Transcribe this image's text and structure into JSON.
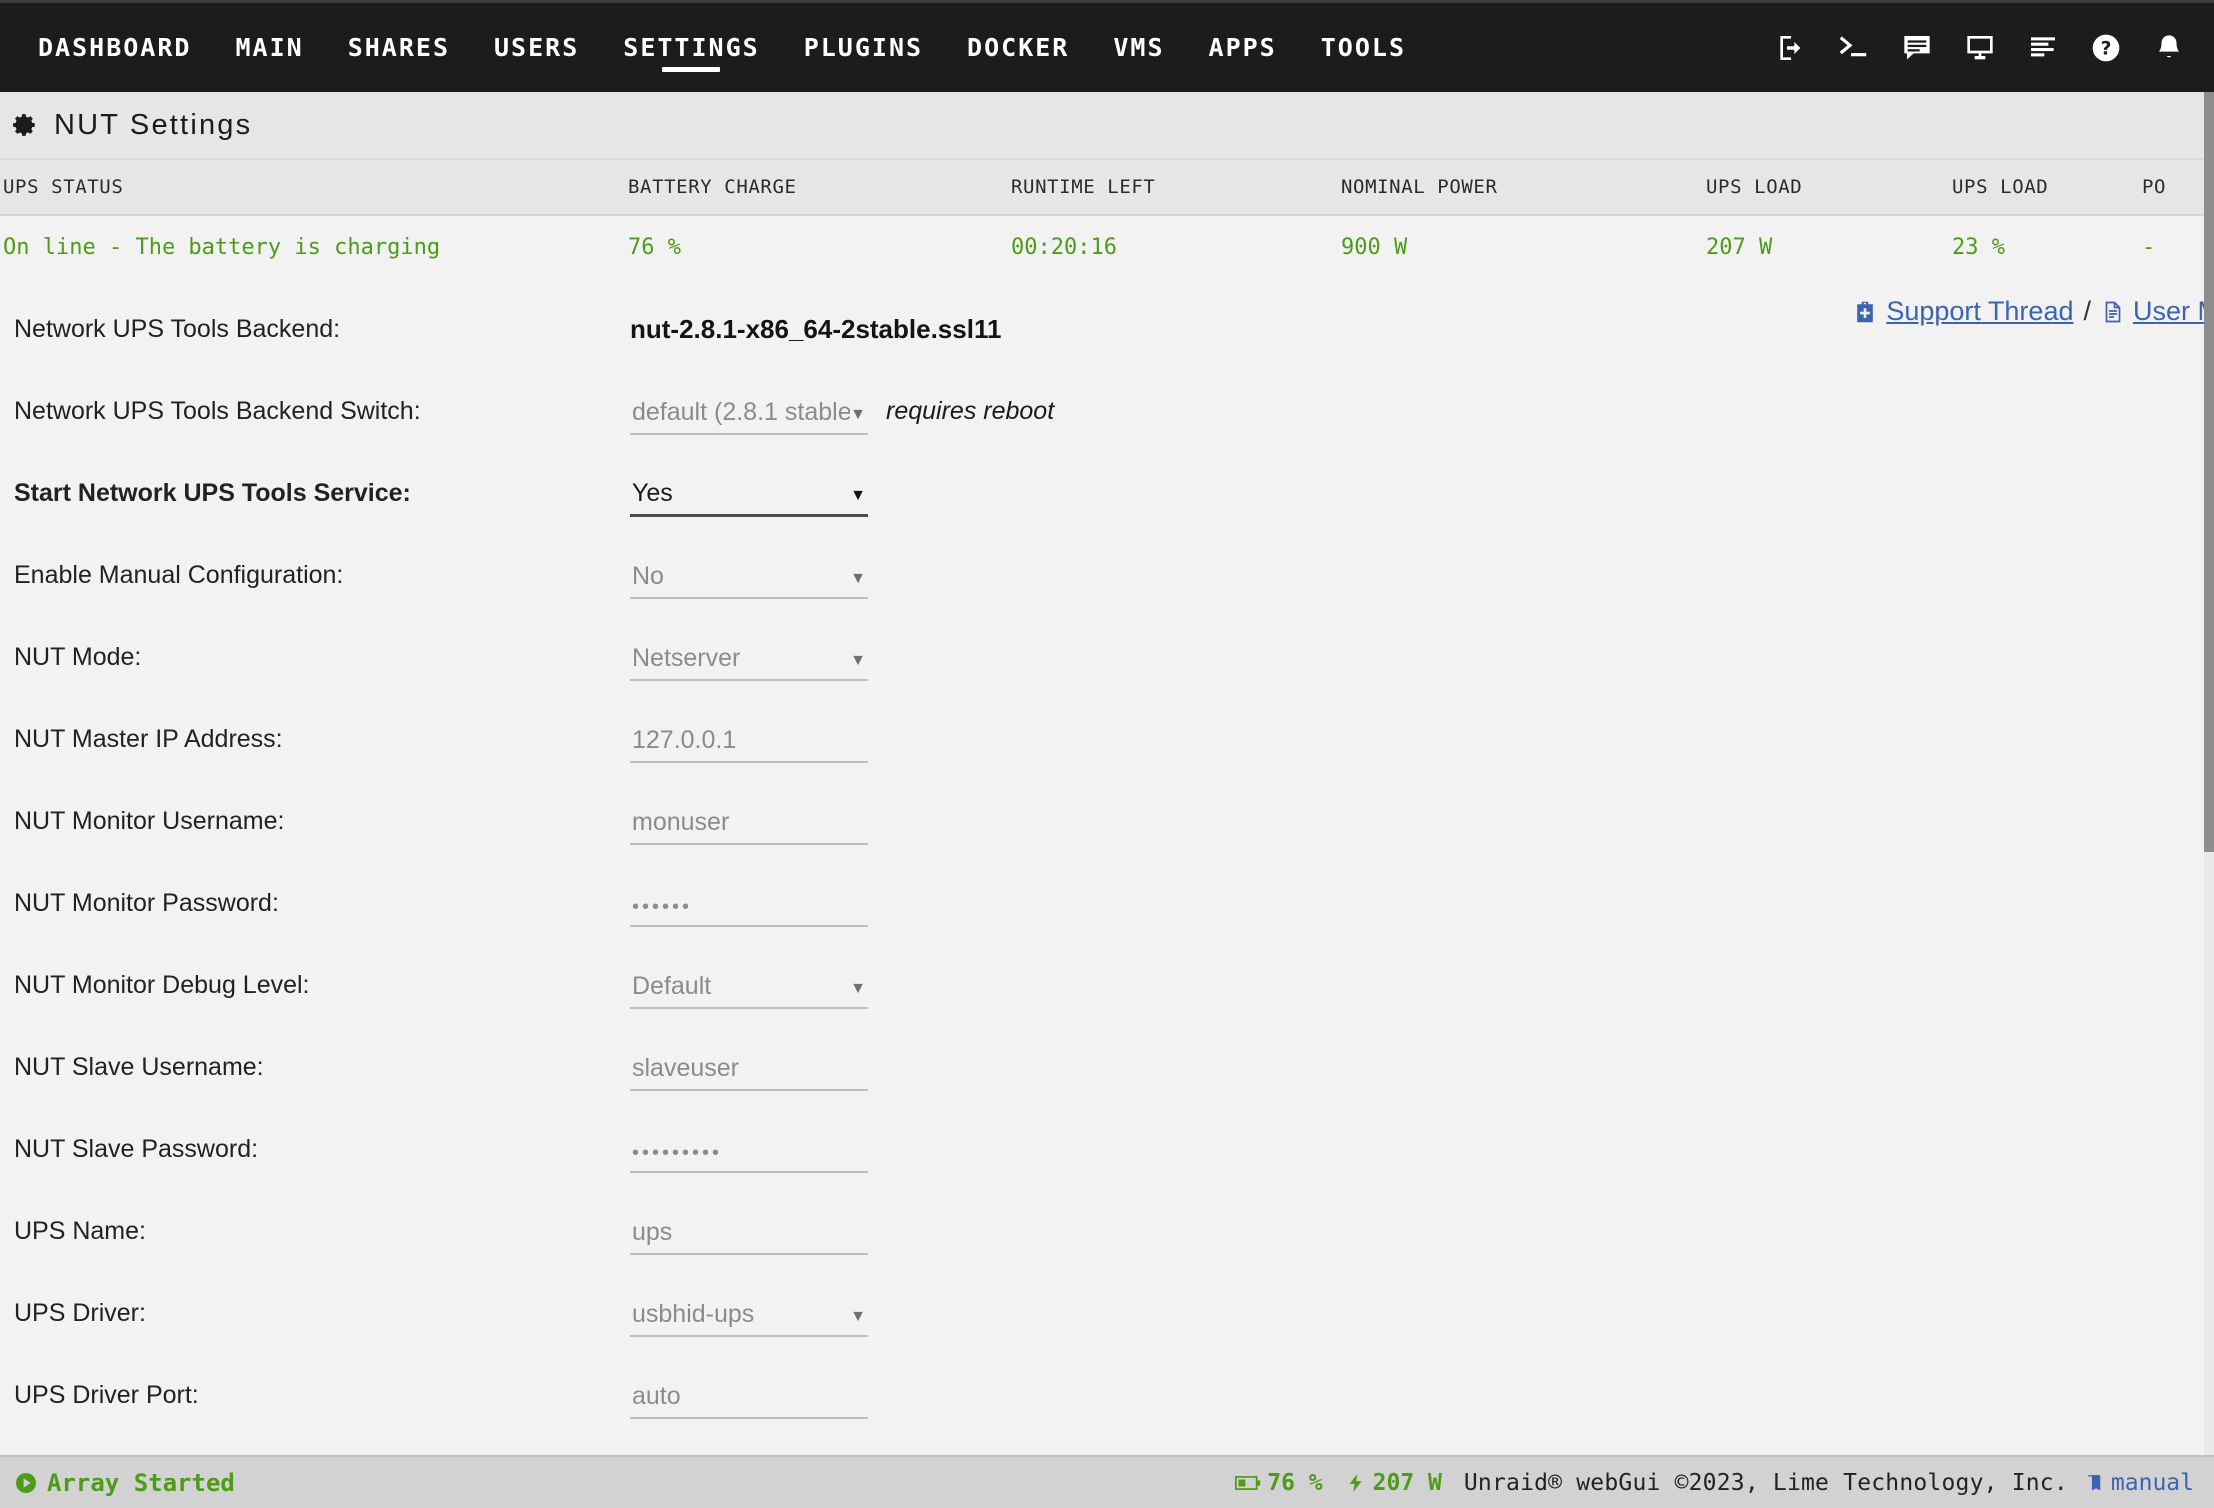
{
  "nav": {
    "items": [
      {
        "label": "DASHBOARD",
        "active": false
      },
      {
        "label": "MAIN",
        "active": false
      },
      {
        "label": "SHARES",
        "active": false
      },
      {
        "label": "USERS",
        "active": false
      },
      {
        "label": "SETTINGS",
        "active": true
      },
      {
        "label": "PLUGINS",
        "active": false
      },
      {
        "label": "DOCKER",
        "active": false
      },
      {
        "label": "VMS",
        "active": false
      },
      {
        "label": "APPS",
        "active": false
      },
      {
        "label": "TOOLS",
        "active": false
      }
    ],
    "icons": [
      "logout-icon",
      "terminal-icon",
      "chat-icon",
      "display-icon",
      "log-icon",
      "help-icon",
      "bell-icon"
    ]
  },
  "page": {
    "title": "NUT Settings",
    "icon": "gear-icon"
  },
  "ups_table": {
    "headers": [
      "UPS STATUS",
      "BATTERY CHARGE",
      "RUNTIME LEFT",
      "NOMINAL POWER",
      "UPS LOAD",
      "UPS LOAD",
      "PO"
    ],
    "values": [
      "On line - The battery is charging",
      "76 %",
      "00:20:16",
      "900 W",
      "207 W",
      "23 %",
      "-"
    ],
    "value_color": "#4d9b19"
  },
  "links": {
    "support": "Support Thread",
    "support_icon": "first-aid-kit-icon",
    "separator": "/",
    "manual": "User M",
    "manual_icon": "document-icon"
  },
  "form": {
    "rows": [
      {
        "label": "Network UPS Tools Backend:",
        "bold": false,
        "type": "text",
        "value": "nut-2.8.1-x86_64-2stable.ssl11"
      },
      {
        "label": "Network UPS Tools Backend Switch:",
        "bold": false,
        "type": "select",
        "value": "default (2.8.1 stable)",
        "enabled": false,
        "note": "requires reboot"
      },
      {
        "label": "Start Network UPS Tools Service:",
        "bold": true,
        "type": "select",
        "value": "Yes",
        "enabled": true,
        "note": ""
      },
      {
        "label": "Enable Manual Configuration:",
        "bold": false,
        "type": "select",
        "value": "No",
        "enabled": false,
        "note": ""
      },
      {
        "label": "NUT Mode:",
        "bold": false,
        "type": "select",
        "value": "Netserver",
        "enabled": false,
        "note": ""
      },
      {
        "label": "NUT Master IP Address:",
        "bold": false,
        "type": "input",
        "value": "127.0.0.1",
        "enabled": false,
        "note": ""
      },
      {
        "label": "NUT Monitor Username:",
        "bold": false,
        "type": "input",
        "value": "monuser",
        "enabled": false,
        "note": ""
      },
      {
        "label": "NUT Monitor Password:",
        "bold": false,
        "type": "password",
        "value": "••••••",
        "enabled": false,
        "note": ""
      },
      {
        "label": "NUT Monitor Debug Level:",
        "bold": false,
        "type": "select",
        "value": "Default",
        "enabled": false,
        "note": ""
      },
      {
        "label": "NUT Slave Username:",
        "bold": false,
        "type": "input",
        "value": "slaveuser",
        "enabled": false,
        "note": ""
      },
      {
        "label": "NUT Slave Password:",
        "bold": false,
        "type": "password",
        "value": "•••••••••",
        "enabled": false,
        "note": ""
      },
      {
        "label": "UPS Name:",
        "bold": false,
        "type": "input",
        "value": "ups",
        "enabled": false,
        "note": ""
      },
      {
        "label": "UPS Driver:",
        "bold": false,
        "type": "select",
        "value": "usbhid-ups",
        "enabled": false,
        "note": ""
      },
      {
        "label": "UPS Driver Port:",
        "bold": false,
        "type": "input",
        "value": "auto",
        "enabled": false,
        "note": ""
      }
    ],
    "dropdown_arrow": "▼"
  },
  "footer": {
    "array_status": "Array Started",
    "array_icon": "play-circle-icon",
    "battery": "76 %",
    "battery_icon": "battery-icon",
    "power": "207 W",
    "power_icon": "plug-icon",
    "copyright": "Unraid® webGui ©2023, Lime Technology, Inc.",
    "manual": "manual",
    "manual_icon": "book-icon",
    "green": "#4d9b19",
    "link_blue": "#3b63b0"
  }
}
